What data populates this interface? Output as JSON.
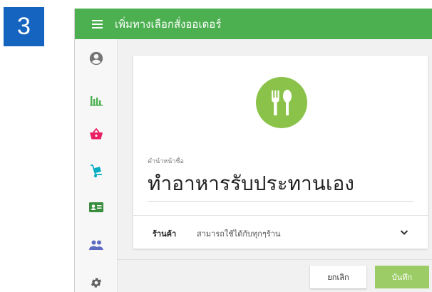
{
  "step_number": "3",
  "appbar": {
    "title": "เพิ่มทางเลือกสั่งออเดอร์"
  },
  "sidebar": {
    "items": [
      {
        "name": "account",
        "icon": "account-circle-icon",
        "color": "#757575"
      },
      {
        "name": "reports",
        "icon": "bar-chart-icon",
        "color": "#4caf50"
      },
      {
        "name": "orders",
        "icon": "shopping-basket-icon",
        "color": "#e91e63"
      },
      {
        "name": "delivery",
        "icon": "dolly-icon",
        "color": "#00acc1"
      },
      {
        "name": "contact",
        "icon": "contact-card-icon",
        "color": "#388e3c"
      },
      {
        "name": "members",
        "icon": "people-icon",
        "color": "#5c6bc0"
      },
      {
        "name": "settings",
        "icon": "gear-icon",
        "color": "#616161"
      }
    ]
  },
  "form": {
    "icon": "fork-spoon-icon",
    "name_label": "คำนำหน้าชื่อ",
    "name_value": "ทำอาหารรับประทานเอง",
    "shop_label": "ร้านค้า",
    "shop_value": "สามารถใช้ได้กับทุกๆร้าน"
  },
  "buttons": {
    "cancel_label": "ยกเลิก",
    "save_label": "บันทึก"
  },
  "colors": {
    "appbar": "#4caf50",
    "badge": "#1565c0",
    "food_circle": "#8bc34a",
    "save_button": "#9ccc65"
  }
}
